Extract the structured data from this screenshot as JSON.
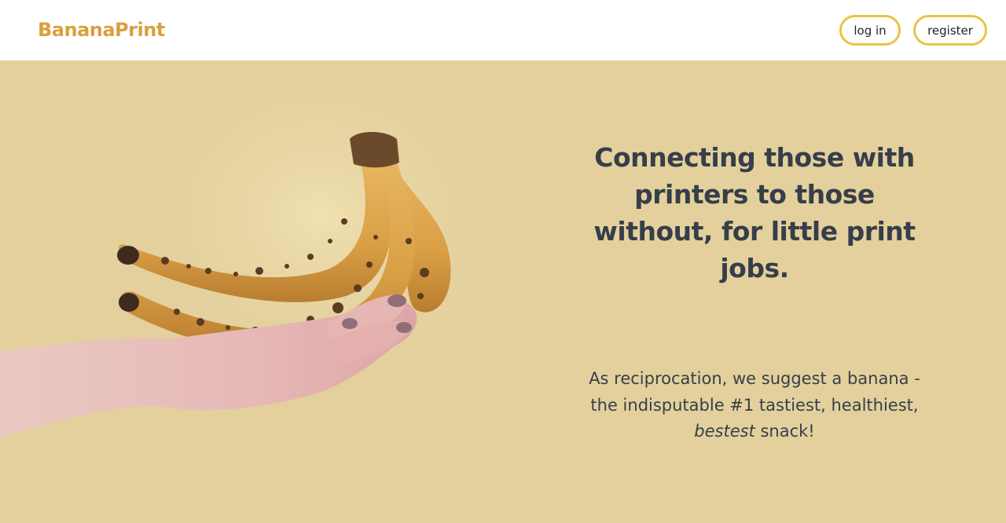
{
  "navbar": {
    "brand": "BananaPrint",
    "login_label": "log in",
    "register_label": "register"
  },
  "hero": {
    "headline": "Connecting those with printers to those without, for little print jobs.",
    "tagline_prefix": "As reciprocation, we suggest a banana - the indisputable #1 tastiest, healthiest,",
    "tagline_emphasis": "bestest",
    "tagline_suffix": "snack!"
  },
  "colors": {
    "brand": "#d9a03c",
    "button_border": "#e8c444",
    "hero_background": "#e3d09c",
    "text": "#373f4a"
  }
}
